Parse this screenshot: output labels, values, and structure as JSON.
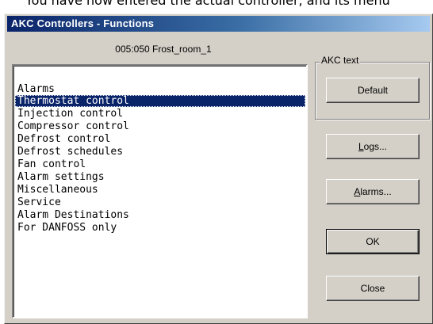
{
  "caption": "You have now entered the actual controller, and its menu",
  "window": {
    "title": "AKC Controllers - Functions",
    "controller_label": "005:050  Frost_room_1"
  },
  "functions_list": {
    "selected_index": 1,
    "items": [
      "Alarms",
      "Thermostat control",
      "Injection control",
      "Compressor control",
      "Defrost control",
      "Defrost schedules",
      "Fan control",
      "Alarm settings",
      "Miscellaneous",
      "Service",
      "Alarm Destinations",
      "For DANFOSS only"
    ]
  },
  "akc_text_group": {
    "label": "AKC text",
    "default_button": "Default"
  },
  "buttons": {
    "logs": {
      "mnemonic": "L",
      "rest": "ogs..."
    },
    "alarms": {
      "mnemonic": "A",
      "rest": "larms..."
    },
    "ok": "OK",
    "close": "Close"
  }
}
